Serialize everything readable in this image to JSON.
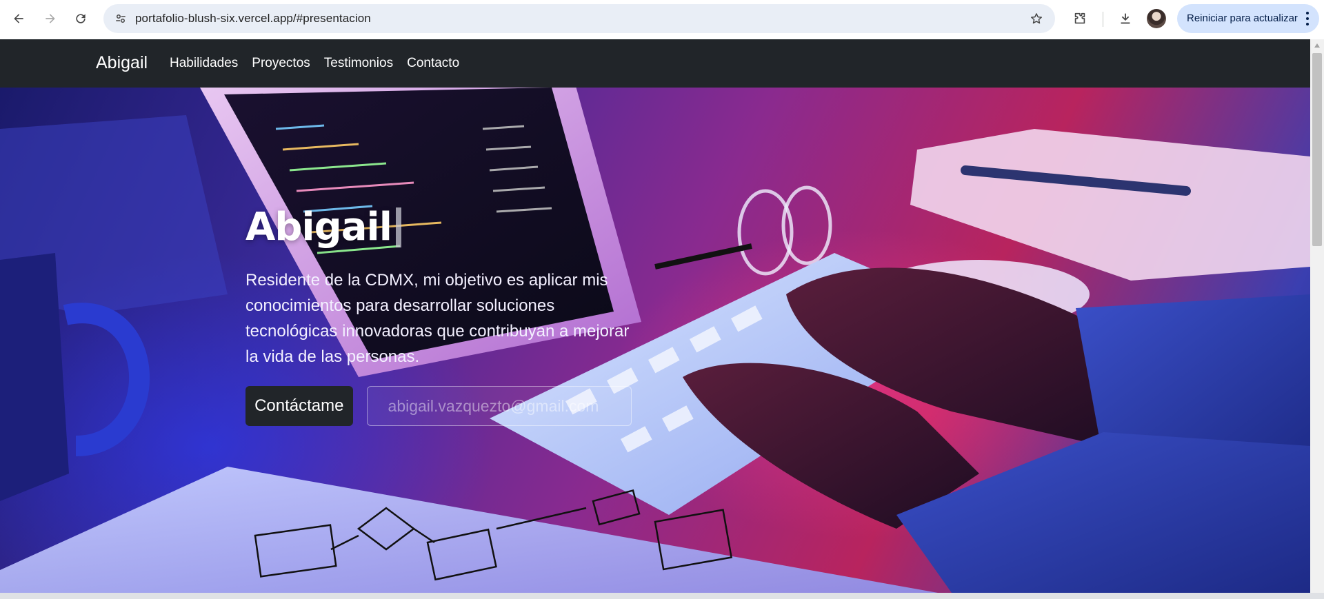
{
  "browser": {
    "url": "portafolio-blush-six.vercel.app/#presentacion",
    "update_button_label": "Reiniciar para actualizar",
    "icons": {
      "back": "arrow-left",
      "forward": "arrow-right",
      "reload": "reload",
      "site_info": "tune",
      "bookmark": "star",
      "extensions": "puzzle",
      "downloads": "download",
      "menu": "three-dots-vertical"
    }
  },
  "navbar": {
    "brand": "Abigail",
    "links": [
      "Habilidades",
      "Proyectos",
      "Testimonios",
      "Contacto"
    ]
  },
  "hero": {
    "title": "Abigail",
    "description": "Residente de la CDMX, mi objetivo es aplicar mis conocimientos para desarrollar soluciones tecnológicas innovadoras que contribuyan a mejorar la vida de las personas.",
    "cta_label": "Contáctame",
    "email_placeholder": "abigail.vazquezto@gmail.com"
  },
  "colors": {
    "navbar_bg": "#212529",
    "omnibox_bg": "#e9eef6",
    "update_button_bg": "#d3e3fd",
    "hero_accent_pink": "#b8245e",
    "hero_accent_blue": "#3a3fb0"
  }
}
